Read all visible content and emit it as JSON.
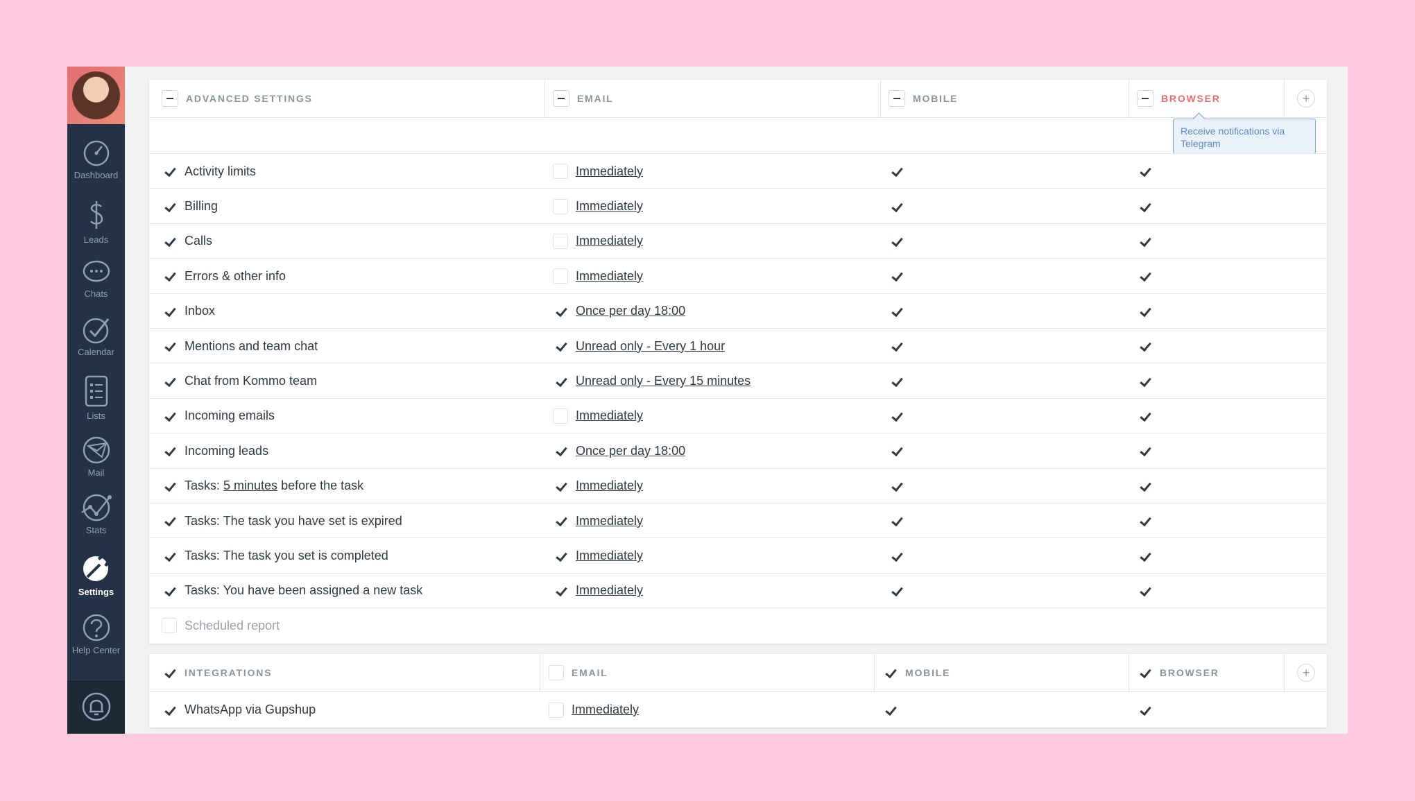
{
  "sidebar": {
    "items": [
      {
        "label": "Dashboard",
        "icon": "dashboard-icon"
      },
      {
        "label": "Leads",
        "icon": "dollar-icon"
      },
      {
        "label": "Chats",
        "icon": "chat-bubble-icon"
      },
      {
        "label": "Calendar",
        "icon": "checkmark-icon"
      },
      {
        "label": "Lists",
        "icon": "list-icon"
      },
      {
        "label": "Mail",
        "icon": "mail-icon"
      },
      {
        "label": "Stats",
        "icon": "stats-icon"
      },
      {
        "label": "Settings",
        "icon": "wrench-icon",
        "active": true
      },
      {
        "label": "Help Center",
        "icon": "question-icon"
      }
    ],
    "bottom_icon": "bell-icon"
  },
  "advanced": {
    "header": {
      "title": "ADVANCED SETTINGS",
      "email": "EMAIL",
      "mobile": "MOBILE",
      "browser": "BROWSER",
      "add": "+"
    },
    "tooltip": "Receive notifications via Telegram",
    "rows": [
      {
        "label": "Activity limits",
        "email_checked": false,
        "freq": "Immediately "
      },
      {
        "label": "Billing",
        "email_checked": false,
        "freq": "Immediately "
      },
      {
        "label": "Calls",
        "email_checked": false,
        "freq": "Immediately "
      },
      {
        "label": "Errors & other info",
        "email_checked": false,
        "freq": "Immediately "
      },
      {
        "label": "Inbox",
        "email_checked": true,
        "freq": "Once per day 18:00"
      },
      {
        "label": "Mentions and team chat",
        "email_checked": true,
        "freq": "Unread only - Every 1 hour"
      },
      {
        "label": "Chat from Kommo team",
        "email_checked": true,
        "freq": "Unread only - Every 15 minutes"
      },
      {
        "label": "Incoming emails",
        "email_checked": false,
        "freq": "Immediately "
      },
      {
        "label": "Incoming leads",
        "email_checked": true,
        "freq": "Once per day 18:00"
      },
      {
        "label_prefix": "Tasks: ",
        "label_link": "5 minutes",
        "label_suffix": " before the task",
        "email_checked": true,
        "freq": "Immediately"
      },
      {
        "label": "Tasks: The task you have set is expired",
        "email_checked": true,
        "freq": "Immediately "
      },
      {
        "label": "Tasks: The task you set is completed",
        "email_checked": true,
        "freq": "Immediately "
      },
      {
        "label": "Tasks: You have been assigned a new task",
        "email_checked": true,
        "freq": "Immediately "
      }
    ],
    "scheduled_report": "Scheduled report"
  },
  "integrations": {
    "header": {
      "title": "INTEGRATIONS",
      "email": "EMAIL",
      "mobile": "MOBILE",
      "browser": "BROWSER",
      "add": "+"
    },
    "rows": [
      {
        "label": "WhatsApp via Gupshup",
        "email_checked": false,
        "freq": "Immediately "
      }
    ]
  }
}
